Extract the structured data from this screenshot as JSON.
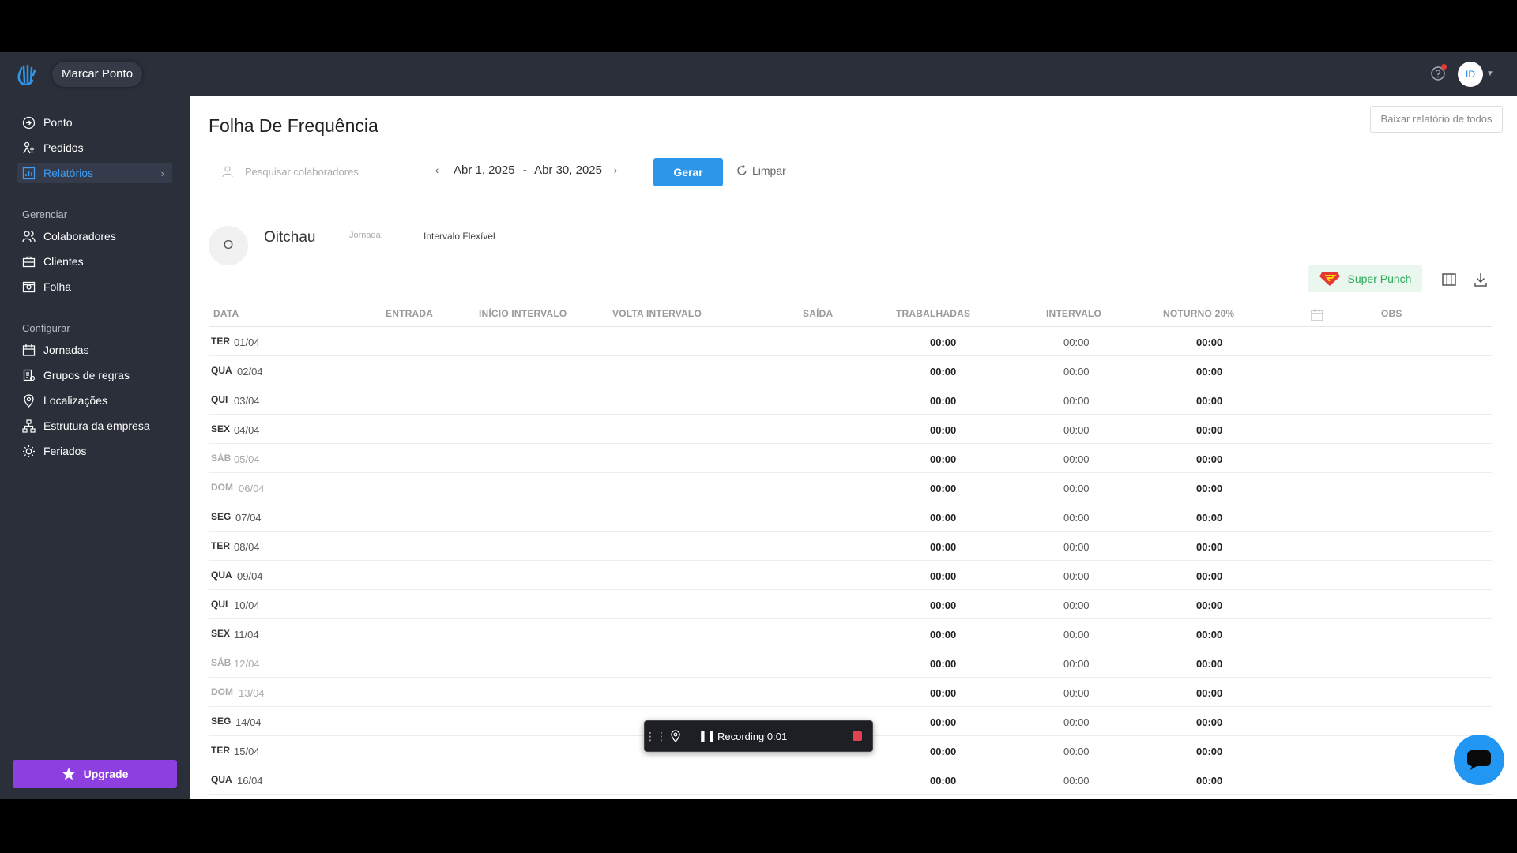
{
  "topbar": {
    "marcar_ponto": "Marcar Ponto",
    "avatar_initials": "ID"
  },
  "sidebar": {
    "items": [
      {
        "label": "Ponto",
        "icon": "login-icon"
      },
      {
        "label": "Pedidos",
        "icon": "person-tree-icon"
      },
      {
        "label": "Relatórios",
        "icon": "chart-icon",
        "active": true
      }
    ],
    "section_manage": "Gerenciar",
    "manage_items": [
      {
        "label": "Colaboradores",
        "icon": "users-icon"
      },
      {
        "label": "Clientes",
        "icon": "briefcase-icon"
      },
      {
        "label": "Folha",
        "icon": "money-icon"
      }
    ],
    "section_config": "Configurar",
    "config_items": [
      {
        "label": "Jornadas",
        "icon": "calendar-icon"
      },
      {
        "label": "Grupos de regras",
        "icon": "rules-icon"
      },
      {
        "label": "Localizações",
        "icon": "location-icon"
      },
      {
        "label": "Estrutura da empresa",
        "icon": "org-chart-icon"
      },
      {
        "label": "Feriados",
        "icon": "sun-icon"
      }
    ],
    "upgrade": "Upgrade"
  },
  "main": {
    "title": "Folha De Frequência",
    "report_all": "Baixar relatório de todos",
    "search_placeholder": "Pesquisar colaboradores",
    "date_start": "Abr 1, 2025",
    "date_sep": "-",
    "date_end": "Abr 30, 2025",
    "generate": "Gerar",
    "clear": "Limpar",
    "employee": {
      "initial": "O",
      "name": "Oitchau",
      "jornada_label": "Jornada:",
      "jornada_value": "Intervalo Flexível"
    },
    "super_punch": "Super Punch"
  },
  "table": {
    "headers": {
      "data": "DATA",
      "entrada": "ENTRADA",
      "inicio": "INÍCIO INTERVALO",
      "volta": "VOLTA INTERVALO",
      "saida": "SAÍDA",
      "trabalhadas": "TRABALHADAS",
      "intervalo": "INTERVALO",
      "noturno": "NOTURNO 20%",
      "obs": "OBS"
    },
    "rows": [
      {
        "dow": "TER",
        "date": "01/04",
        "trabalhadas": "00:00",
        "intervalo": "00:00",
        "noturno": "00:00"
      },
      {
        "dow": "QUA",
        "date": "02/04",
        "trabalhadas": "00:00",
        "intervalo": "00:00",
        "noturno": "00:00"
      },
      {
        "dow": "QUI",
        "date": "03/04",
        "trabalhadas": "00:00",
        "intervalo": "00:00",
        "noturno": "00:00"
      },
      {
        "dow": "SEX",
        "date": "04/04",
        "trabalhadas": "00:00",
        "intervalo": "00:00",
        "noturno": "00:00"
      },
      {
        "dow": "SÁB",
        "date": "05/04",
        "trabalhadas": "00:00",
        "intervalo": "00:00",
        "noturno": "00:00",
        "weekend": true
      },
      {
        "dow": "DOM",
        "date": "06/04",
        "trabalhadas": "00:00",
        "intervalo": "00:00",
        "noturno": "00:00",
        "weekend": true
      },
      {
        "dow": "SEG",
        "date": "07/04",
        "trabalhadas": "00:00",
        "intervalo": "00:00",
        "noturno": "00:00"
      },
      {
        "dow": "TER",
        "date": "08/04",
        "trabalhadas": "00:00",
        "intervalo": "00:00",
        "noturno": "00:00"
      },
      {
        "dow": "QUA",
        "date": "09/04",
        "trabalhadas": "00:00",
        "intervalo": "00:00",
        "noturno": "00:00"
      },
      {
        "dow": "QUI",
        "date": "10/04",
        "trabalhadas": "00:00",
        "intervalo": "00:00",
        "noturno": "00:00"
      },
      {
        "dow": "SEX",
        "date": "11/04",
        "trabalhadas": "00:00",
        "intervalo": "00:00",
        "noturno": "00:00"
      },
      {
        "dow": "SÁB",
        "date": "12/04",
        "trabalhadas": "00:00",
        "intervalo": "00:00",
        "noturno": "00:00",
        "weekend": true
      },
      {
        "dow": "DOM",
        "date": "13/04",
        "trabalhadas": "00:00",
        "intervalo": "00:00",
        "noturno": "00:00",
        "weekend": true
      },
      {
        "dow": "SEG",
        "date": "14/04",
        "trabalhadas": "00:00",
        "intervalo": "00:00",
        "noturno": "00:00"
      },
      {
        "dow": "TER",
        "date": "15/04",
        "trabalhadas": "00:00",
        "intervalo": "00:00",
        "noturno": "00:00"
      },
      {
        "dow": "QUA",
        "date": "16/04",
        "trabalhadas": "00:00",
        "intervalo": "00:00",
        "noturno": "00:00"
      }
    ]
  },
  "recorder": {
    "label": "Recording 0:01"
  },
  "colors": {
    "sidebar_bg": "#2b2f3a",
    "accent_blue": "#2e96e8",
    "upgrade_purple": "#8e3fe0",
    "super_punch_green": "#2ea85a",
    "stop_red": "#e0424e"
  }
}
